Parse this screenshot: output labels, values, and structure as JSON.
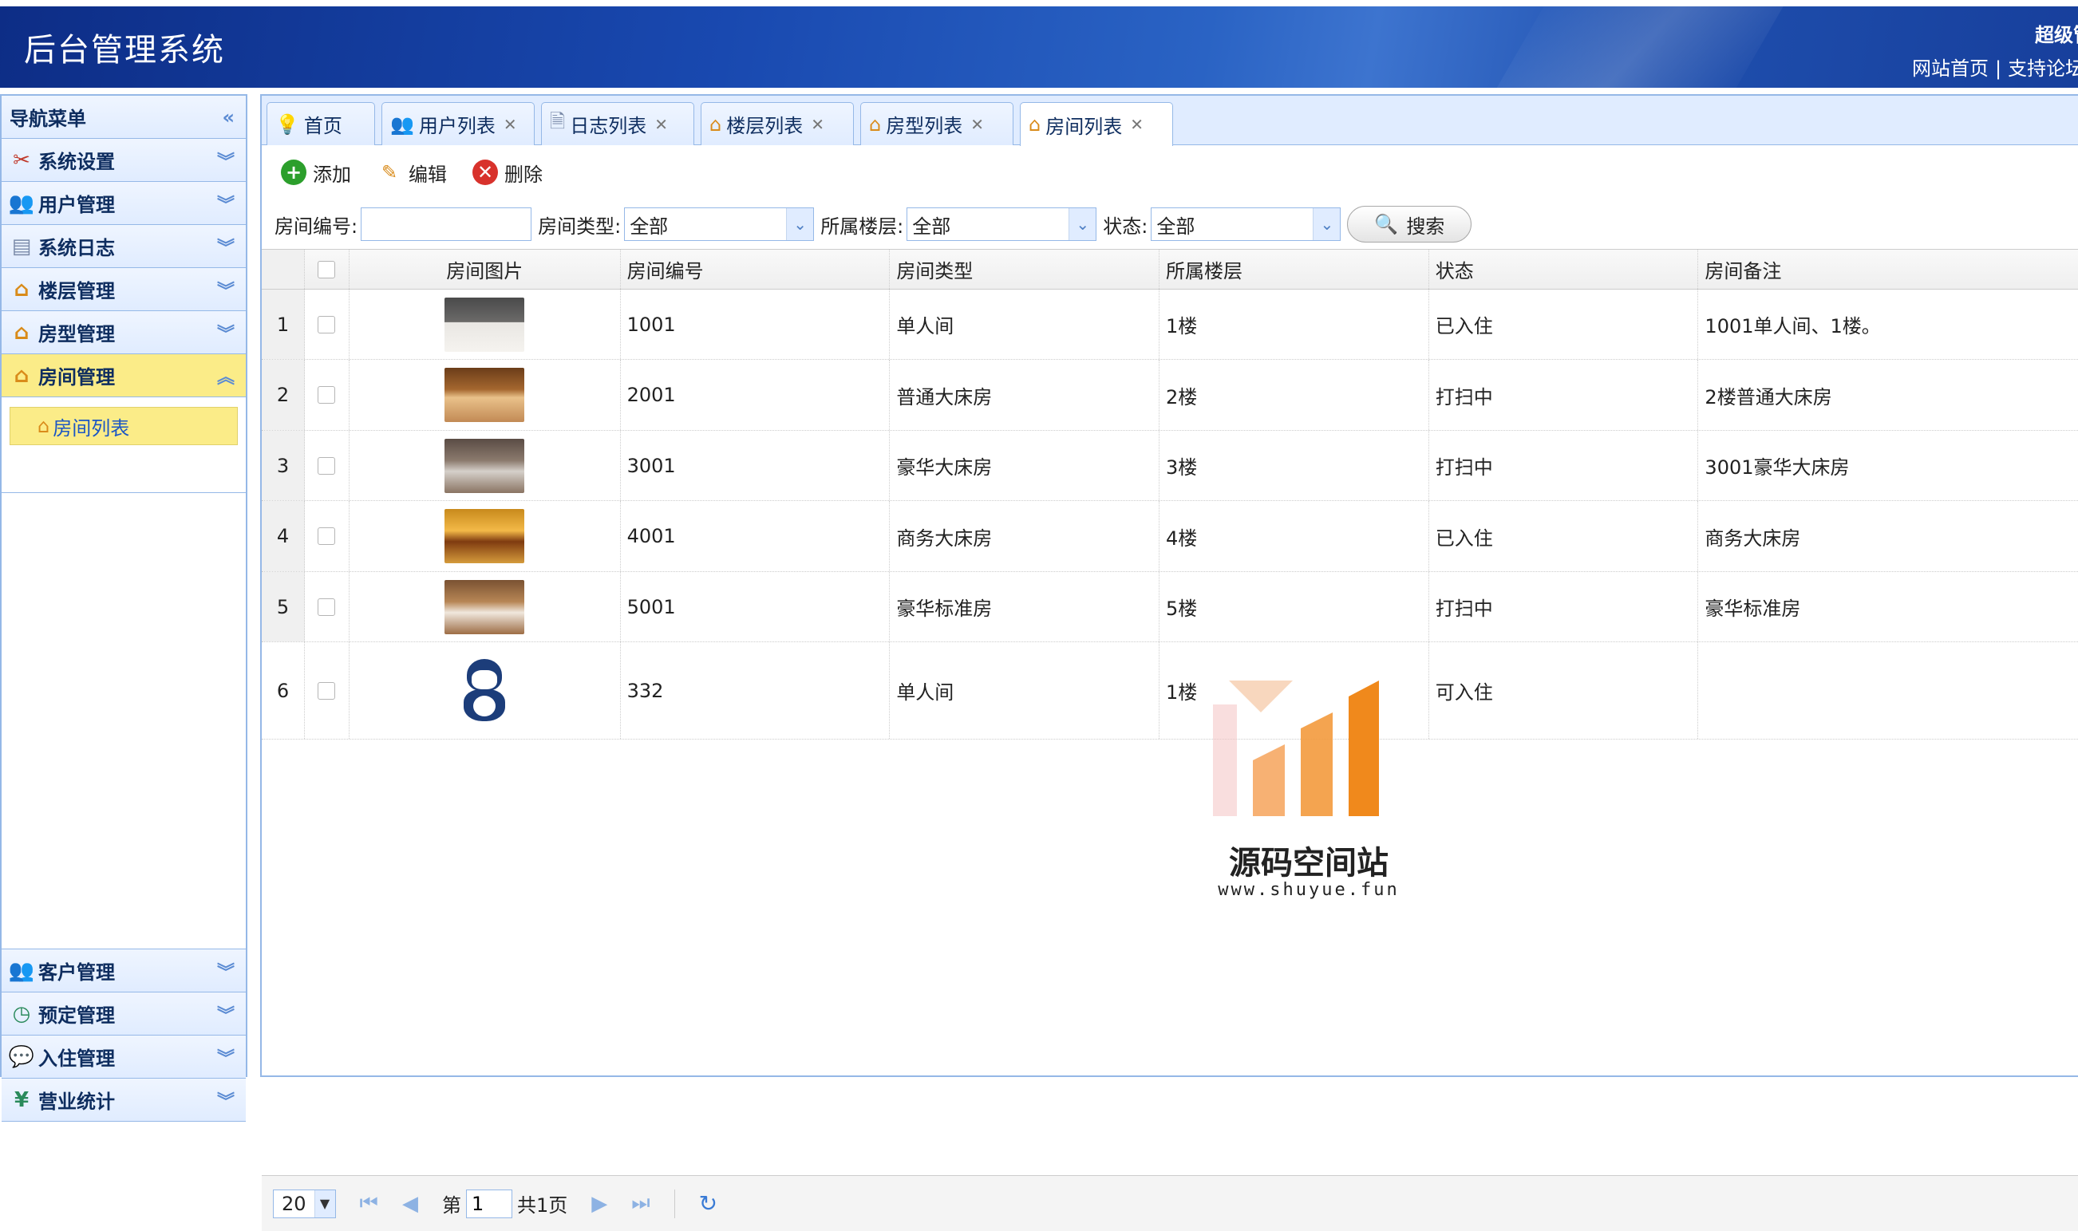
{
  "header": {
    "title": "后台管理系统",
    "user": "超级管",
    "links": [
      "网站首页",
      "支持论坛"
    ],
    "separator": "|"
  },
  "sidebar": {
    "title": "导航菜单",
    "collapse_icon": "double-chevron-left-icon",
    "top_items": [
      {
        "label": "系统设置",
        "icon": "tools-icon"
      },
      {
        "label": "用户管理",
        "icon": "users-icon"
      },
      {
        "label": "系统日志",
        "icon": "log-icon"
      },
      {
        "label": "楼层管理",
        "icon": "house-icon"
      },
      {
        "label": "房型管理",
        "icon": "house-icon"
      },
      {
        "label": "房间管理",
        "icon": "house-icon",
        "active": true
      }
    ],
    "sub_item": {
      "label": "房间列表",
      "icon": "house-icon"
    },
    "bottom_items": [
      {
        "label": "客户管理",
        "icon": "users-icon"
      },
      {
        "label": "预定管理",
        "icon": "clock-icon"
      },
      {
        "label": "入住管理",
        "icon": "chat-icon"
      },
      {
        "label": "营业统计",
        "icon": "yen-icon"
      }
    ]
  },
  "tabs": [
    {
      "label": "首页",
      "icon": "lightbulb-icon",
      "closable": false
    },
    {
      "label": "用户列表",
      "icon": "users-icon",
      "closable": true
    },
    {
      "label": "日志列表",
      "icon": "document-icon",
      "closable": true
    },
    {
      "label": "楼层列表",
      "icon": "house-icon",
      "closable": true
    },
    {
      "label": "房型列表",
      "icon": "house-icon",
      "closable": true
    },
    {
      "label": "房间列表",
      "icon": "house-icon",
      "closable": true,
      "active": true
    }
  ],
  "toolbar": {
    "add_label": "添加",
    "edit_label": "编辑",
    "delete_label": "删除"
  },
  "search": {
    "room_no_label": "房间编号:",
    "room_no_value": "",
    "room_type_label": "房间类型:",
    "room_type_value": "全部",
    "floor_label": "所属楼层:",
    "floor_value": "全部",
    "status_label": "状态:",
    "status_value": "全部",
    "search_label": "搜索"
  },
  "table": {
    "columns": [
      "房间图片",
      "房间编号",
      "房间类型",
      "所属楼层",
      "状态",
      "房间备注"
    ],
    "rows": [
      {
        "rn": "1",
        "no": "1001",
        "type": "单人间",
        "floor": "1楼",
        "status": "已入住",
        "note": "1001单人间、1楼。"
      },
      {
        "rn": "2",
        "no": "2001",
        "type": "普通大床房",
        "floor": "2楼",
        "status": "打扫中",
        "note": "2楼普通大床房"
      },
      {
        "rn": "3",
        "no": "3001",
        "type": "豪华大床房",
        "floor": "3楼",
        "status": "打扫中",
        "note": "3001豪华大床房"
      },
      {
        "rn": "4",
        "no": "4001",
        "type": "商务大床房",
        "floor": "4楼",
        "status": "已入住",
        "note": "商务大床房"
      },
      {
        "rn": "5",
        "no": "5001",
        "type": "豪华标准房",
        "floor": "5楼",
        "status": "打扫中",
        "note": "豪华标准房"
      },
      {
        "rn": "6",
        "no": "332",
        "type": "单人间",
        "floor": "1楼",
        "status": "可入住",
        "note": ""
      }
    ]
  },
  "pager": {
    "page_size": "20",
    "page_prefix": "第",
    "page_value": "1",
    "page_total": "共1页"
  },
  "watermark": {
    "title": "源码空间站",
    "url": "www.shuyue.fun"
  }
}
